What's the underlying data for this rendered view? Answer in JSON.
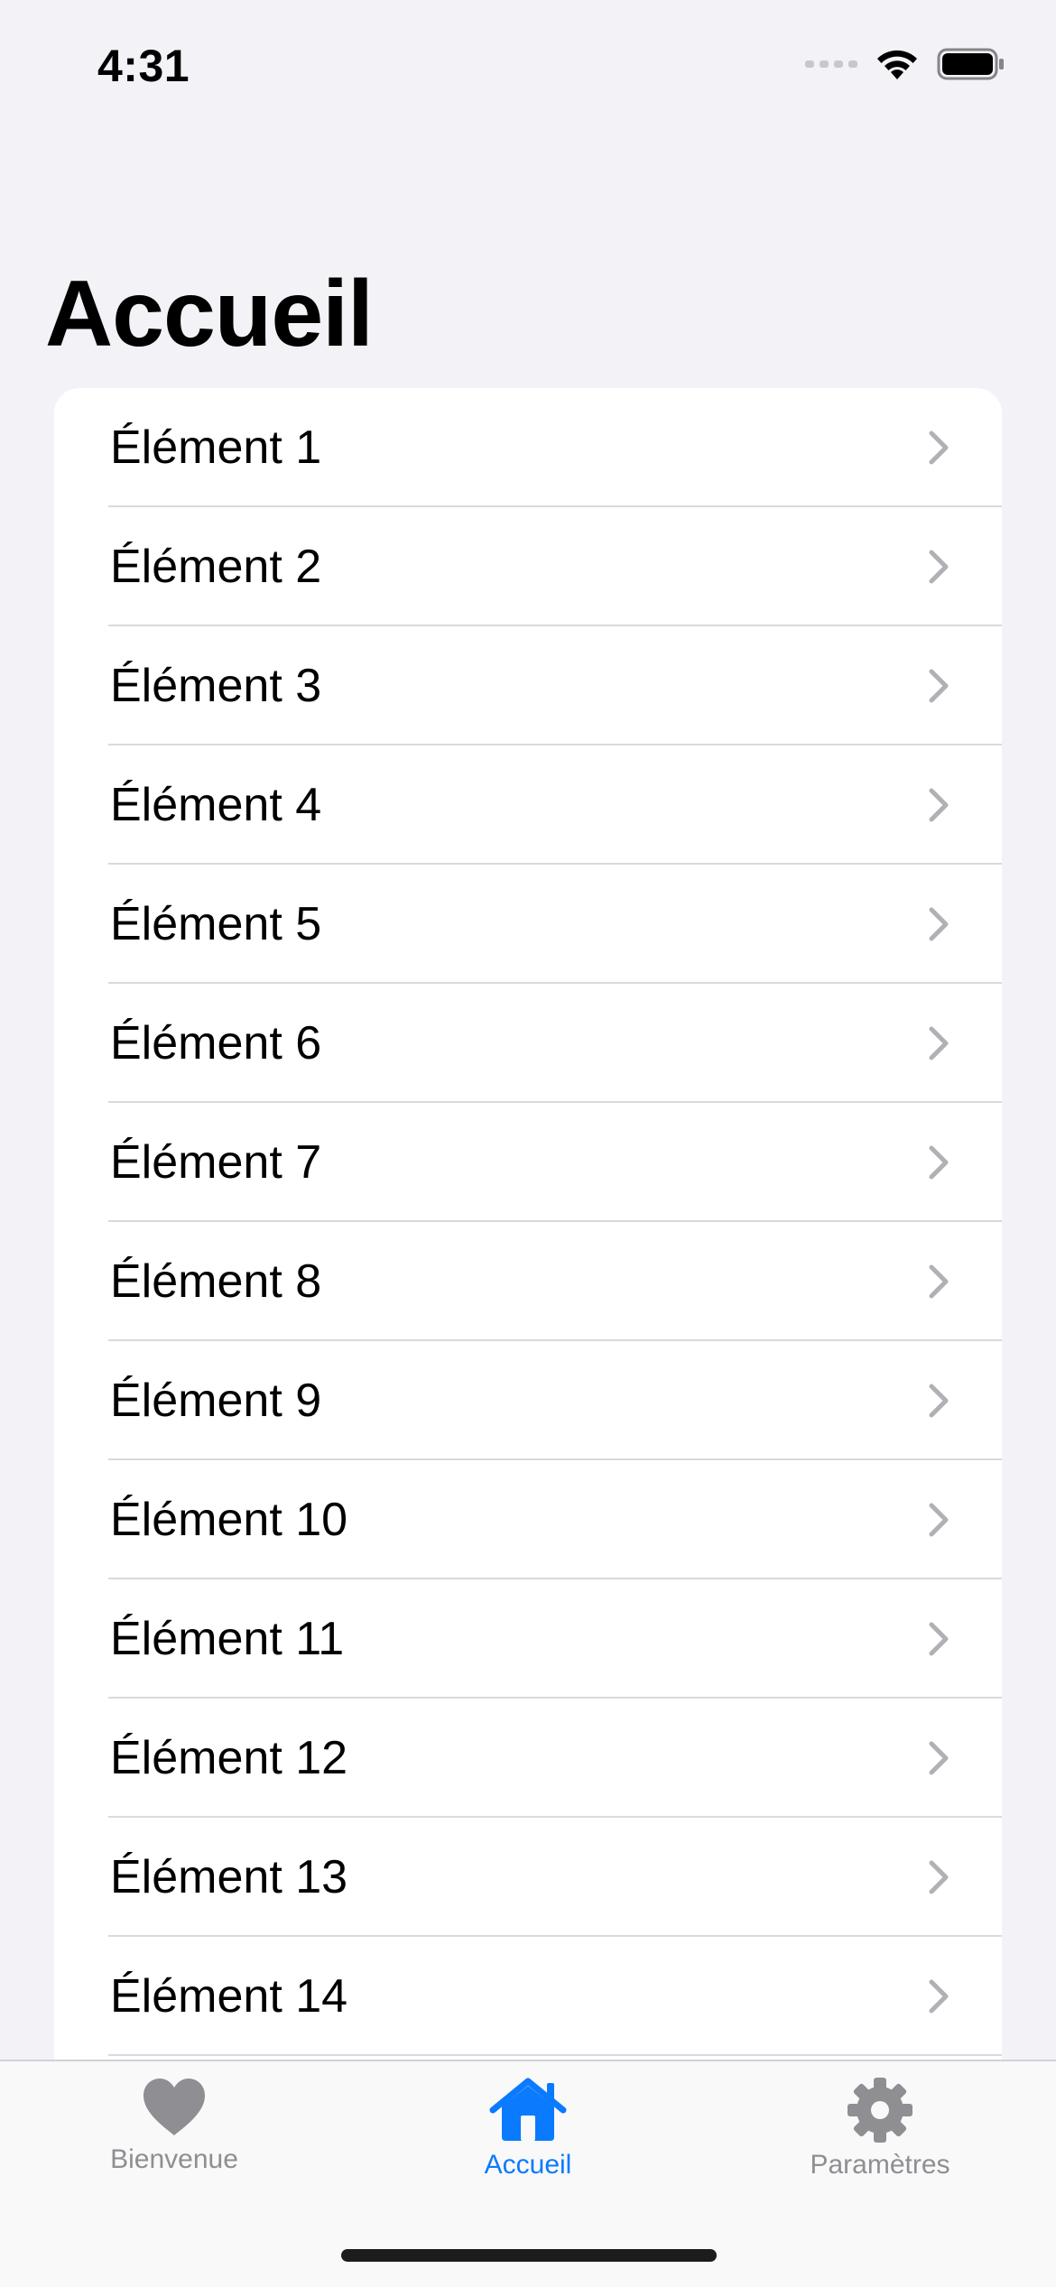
{
  "status_bar": {
    "time": "4:31"
  },
  "header": {
    "title": "Accueil"
  },
  "list": {
    "items": [
      {
        "label": "Élément 1"
      },
      {
        "label": "Élément 2"
      },
      {
        "label": "Élément 3"
      },
      {
        "label": "Élément 4"
      },
      {
        "label": "Élément 5"
      },
      {
        "label": "Élément 6"
      },
      {
        "label": "Élément 7"
      },
      {
        "label": "Élément 8"
      },
      {
        "label": "Élément 9"
      },
      {
        "label": "Élément 10"
      },
      {
        "label": "Élément 11"
      },
      {
        "label": "Élément 12"
      },
      {
        "label": "Élément 13"
      },
      {
        "label": "Élément 14"
      }
    ]
  },
  "tab_bar": {
    "tabs": [
      {
        "label": "Bienvenue",
        "icon": "heart-icon",
        "active": false
      },
      {
        "label": "Accueil",
        "icon": "house-icon",
        "active": true
      },
      {
        "label": "Paramètres",
        "icon": "gear-icon",
        "active": false
      }
    ]
  },
  "colors": {
    "accent": "#0a7aff",
    "inactive": "#8e8e93",
    "background": "#f2f2f7"
  }
}
